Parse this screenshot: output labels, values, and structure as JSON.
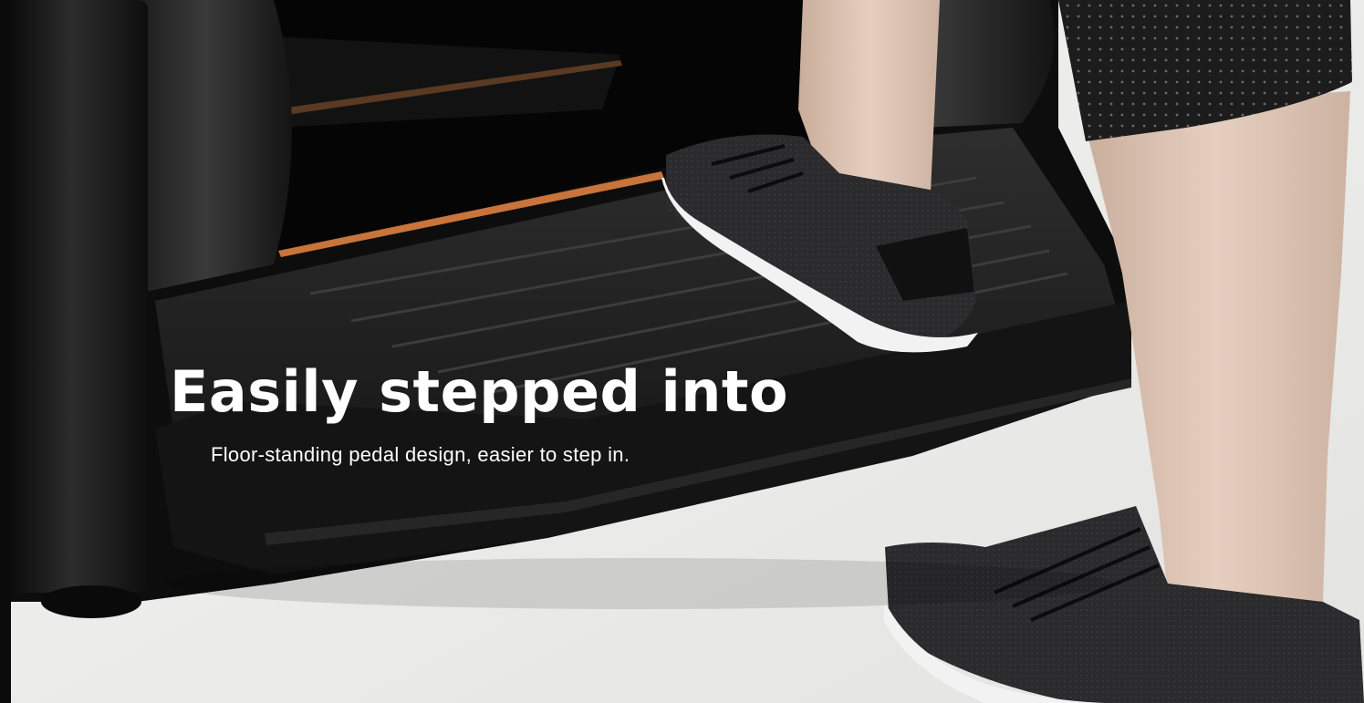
{
  "banner": {
    "headline": "Easily stepped into",
    "subline": "Floor-standing pedal design, easier to step in."
  },
  "colors": {
    "machine_body": "#111111",
    "accent_stripe": "#c8743a",
    "floor": "#ededeb",
    "shoe": "#2b2a2c",
    "sole": "#f2f2f2",
    "skin": "#d9bfae",
    "headline_text": "#ffffff"
  }
}
